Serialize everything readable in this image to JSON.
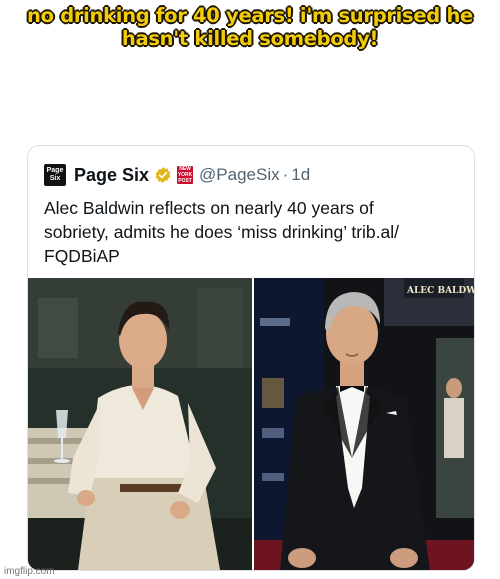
{
  "caption": {
    "line1": "no drinking for 40 years! i'm surprised he",
    "line2": "hasn't killed somebody!"
  },
  "tweet": {
    "logo_line1": "Page",
    "logo_line2": "Six",
    "display_name": "Page Six",
    "affiliate_line1": "NEW",
    "affiliate_line2": "YORK",
    "affiliate_line3": "POST",
    "handle": "@PageSix",
    "separator": "·",
    "time": "1d",
    "text_line1": "Alec Baldwin reflects on nearly 40 years of",
    "text_line2": "sobriety, admits he does ‘miss drinking’ trib.al/",
    "text_line3": "FQDBiAP"
  },
  "photo_right": {
    "marquee_text": "ALEC BALDWIN"
  },
  "watermark": "imgflip.com",
  "colors": {
    "caption_fill": "#f2cc0c",
    "verified": "#e2b719",
    "affiliate_red": "#c8102e",
    "carpet_red": "#6e1420"
  },
  "icons": [
    "verified-badge-icon",
    "new-york-post-badge-icon"
  ]
}
